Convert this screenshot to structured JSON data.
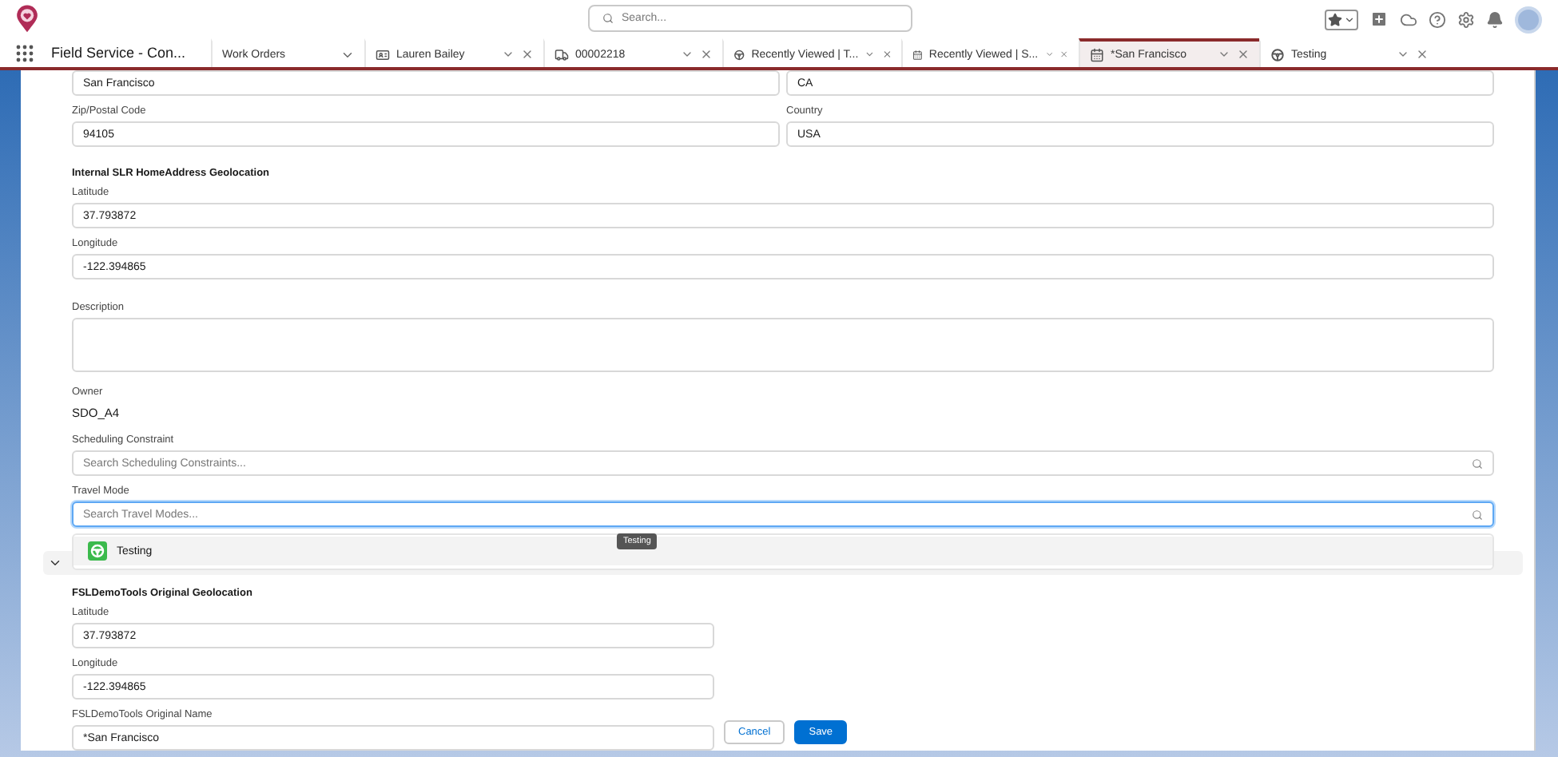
{
  "header": {
    "search_placeholder": "Search..."
  },
  "app_name": "Field Service - Con...",
  "tabs": [
    {
      "label": "Work Orders",
      "kind": "nav",
      "selected": false
    },
    {
      "label": "Lauren Bailey",
      "kind": "record",
      "selected": false
    },
    {
      "label": "00002218",
      "kind": "record",
      "selected": false
    },
    {
      "label": "Recently Viewed | T...",
      "kind": "record",
      "selected": false
    },
    {
      "label": "Recently Viewed | S...",
      "kind": "record",
      "selected": false
    },
    {
      "label": "*San Francisco",
      "kind": "record",
      "selected": true
    },
    {
      "label": "Testing",
      "kind": "record",
      "selected": false
    }
  ],
  "form": {
    "items": [
      {
        "kind": "pair",
        "fields": [
          {
            "value": "San Francisco"
          },
          {
            "value": "CA"
          }
        ]
      },
      {
        "kind": "pair",
        "fields": [
          {
            "label": "Zip/Postal Code",
            "value": "94105"
          },
          {
            "label": "Country",
            "value": "USA"
          }
        ]
      },
      {
        "kind": "heading",
        "text": "Internal SLR HomeAddress Geolocation"
      },
      {
        "kind": "input",
        "label": "Latitude",
        "value": "37.793872"
      },
      {
        "kind": "input",
        "label": "Longitude",
        "value": "-122.394865"
      },
      {
        "kind": "textarea",
        "label": "Description"
      },
      {
        "kind": "readonly",
        "label": "Owner",
        "value": "SDO_A4"
      },
      {
        "kind": "lookup",
        "label": "Scheduling Constraint",
        "placeholder": "Search Scheduling Constraints...",
        "focused": false
      },
      {
        "kind": "lookup",
        "label": "Travel Mode",
        "placeholder": "Search Travel Modes...",
        "focused": true,
        "options": [
          {
            "label": "Testing",
            "selected": true
          }
        ],
        "tooltip": "Testing"
      },
      {
        "kind": "section",
        "expanded": true,
        "items": [
          {
            "kind": "heading",
            "text": "FSLDemoTools Original Geolocation"
          },
          {
            "kind": "input",
            "label": "Latitude",
            "value": "37.793872"
          },
          {
            "kind": "input",
            "label": "Longitude",
            "value": "-122.394865"
          },
          {
            "kind": "input",
            "label": "FSLDemoTools Original Name",
            "value": "*San Francisco"
          }
        ]
      }
    ]
  },
  "footer": {
    "buttons": [
      {
        "label": "Cancel",
        "kind": "neutral"
      },
      {
        "label": "Save",
        "kind": "brand"
      }
    ]
  }
}
